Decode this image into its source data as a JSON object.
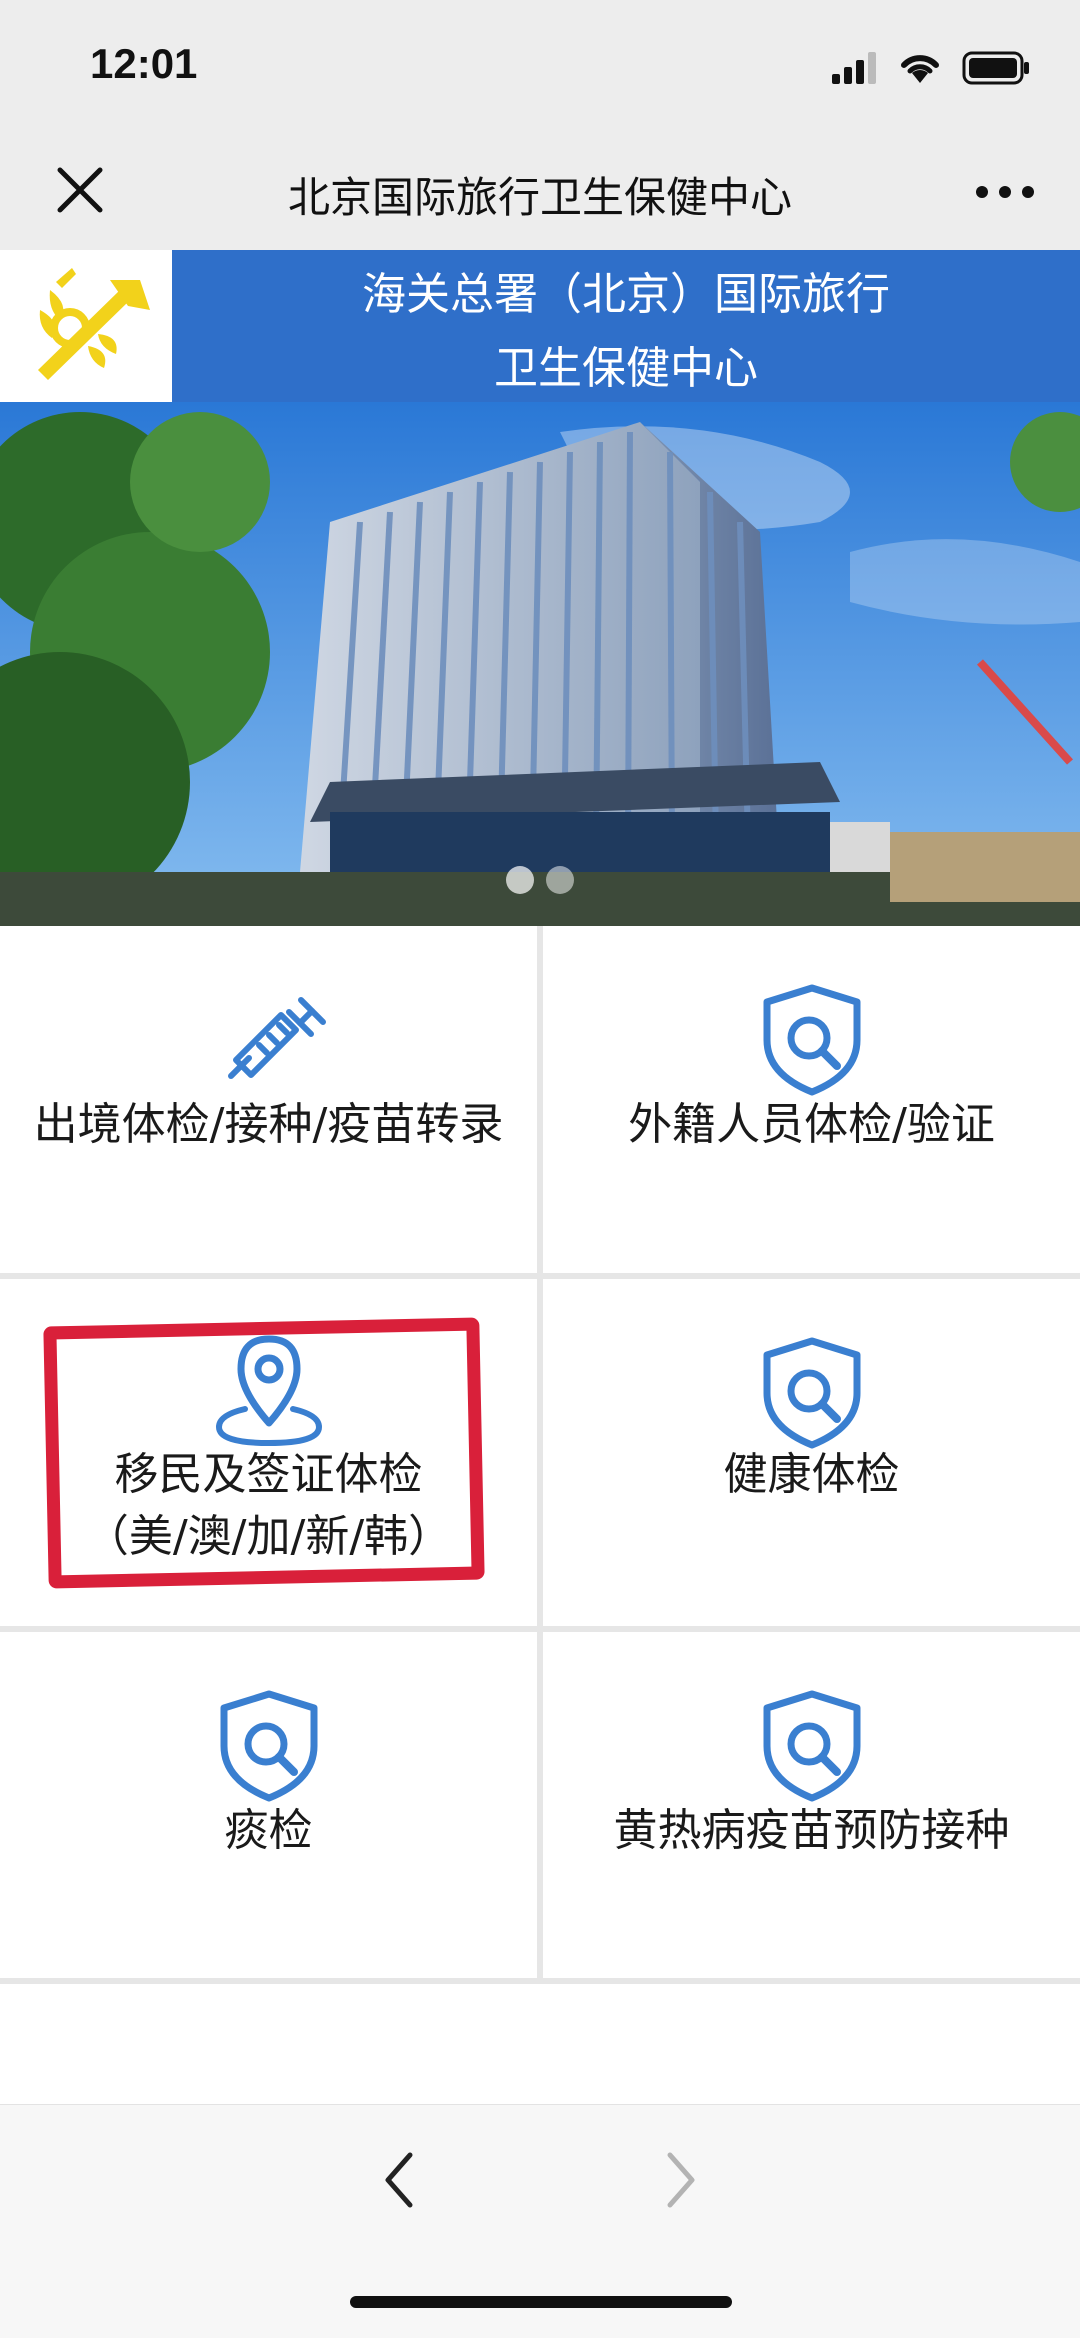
{
  "status_bar": {
    "time": "12:01"
  },
  "nav": {
    "title": "北京国际旅行卫生保健中心"
  },
  "header": {
    "title_line1": "海关总署（北京）国际旅行",
    "title_line2": "卫生保健中心"
  },
  "services": [
    {
      "label_line1": "出境体检/接种/疫苗转录",
      "label_line2": "",
      "icon": "syringe-icon"
    },
    {
      "label_line1": "外籍人员体检/验证",
      "label_line2": "",
      "icon": "shield-search-icon"
    },
    {
      "label_line1": "移民及签证体检",
      "label_line2": "（美/澳/加/新/韩）",
      "icon": "location-pin-icon"
    },
    {
      "label_line1": "健康体检",
      "label_line2": "",
      "icon": "shield-search-icon"
    },
    {
      "label_line1": "痰检",
      "label_line2": "",
      "icon": "shield-search-icon"
    },
    {
      "label_line1": "黄热病疫苗预防接种",
      "label_line2": "",
      "icon": "shield-search-icon"
    }
  ],
  "colors": {
    "header_blue": "#2f6fc9",
    "icon_blue": "#3a7fd0",
    "annotation_red": "#d9203a",
    "logo_yellow": "#f2d21b"
  }
}
